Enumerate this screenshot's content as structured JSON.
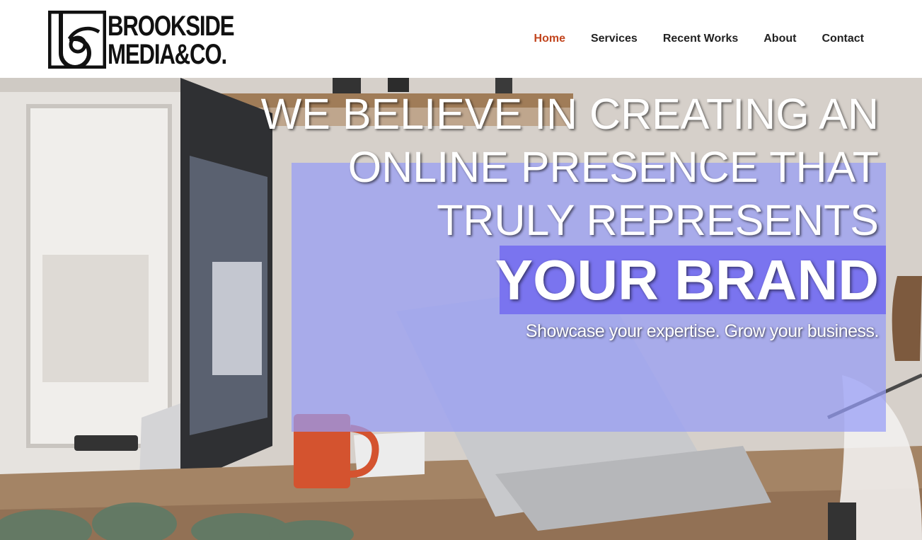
{
  "brand": {
    "logo_line1": "BROOKSIDE",
    "logo_line2": "MEDIA&CO.",
    "logo_icon": "b-monogram-icon"
  },
  "nav": {
    "items": [
      {
        "label": "Home",
        "active": true
      },
      {
        "label": "Services",
        "active": false
      },
      {
        "label": "Recent Works",
        "active": false
      },
      {
        "label": "About",
        "active": false
      },
      {
        "label": "Contact",
        "active": false
      }
    ],
    "active_color": "#c2451e",
    "text_color": "#222222"
  },
  "hero": {
    "headline_lines": [
      "WE BELIEVE IN CREATING AN",
      "ONLINE PRESENCE THAT",
      "TRULY REPRESENTS"
    ],
    "headline_emphasis": "YOUR BRAND",
    "tagline": "Showcase your expertise. Grow your business.",
    "panel_color": "#969cf6",
    "emphasis_color": "#7a74ef",
    "background_image": "office desk with iMac, laptop and red Nescafe mug"
  }
}
